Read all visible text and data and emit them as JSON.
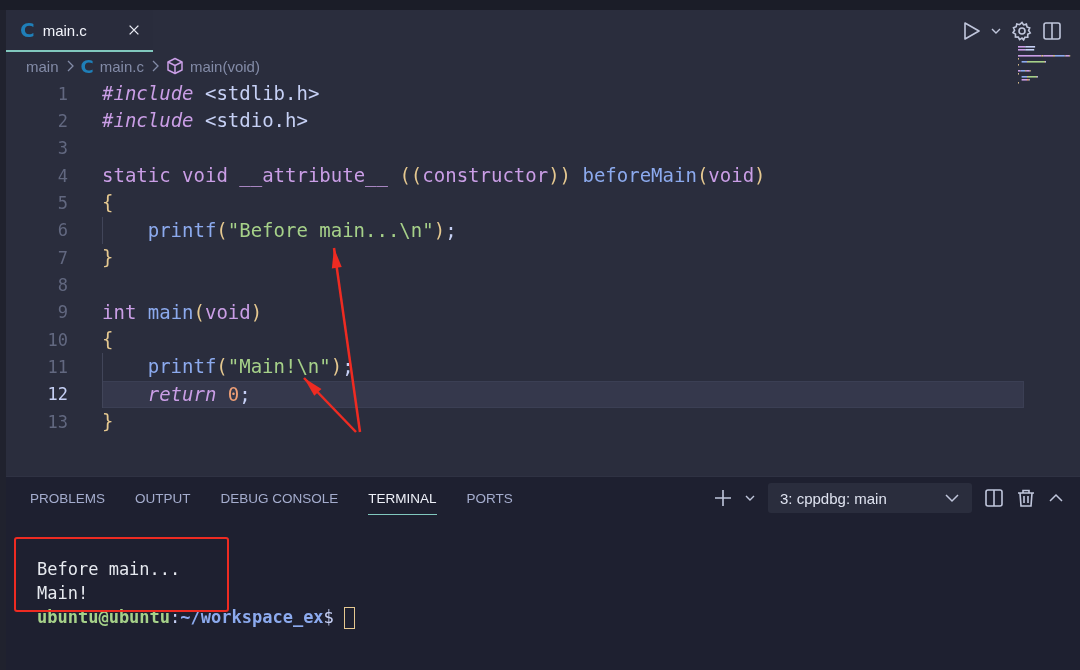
{
  "editor_tabs": [
    {
      "icon": "C",
      "label": "main.c",
      "selected": true
    }
  ],
  "breadcrumbs": [
    {
      "kind": "folder",
      "label": "main"
    },
    {
      "kind": "file",
      "icon": "C",
      "label": "main.c"
    },
    {
      "kind": "symbol",
      "label": "main(void)"
    }
  ],
  "code_lines": [
    {
      "number": "1",
      "current": false,
      "indented": false,
      "tokens": [
        {
          "kind": "directive",
          "text": "#include"
        },
        {
          "kind": "plain",
          "text": " <stdlib.h>"
        }
      ]
    },
    {
      "number": "2",
      "current": false,
      "indented": false,
      "tokens": [
        {
          "kind": "directive",
          "text": "#include"
        },
        {
          "kind": "plain",
          "text": " <stdio.h>"
        }
      ]
    },
    {
      "number": "3",
      "current": false,
      "indented": false
    },
    {
      "number": "4",
      "current": false,
      "indented": false,
      "tokens": [
        {
          "kind": "keyword",
          "text": "static void __attribute__ "
        },
        {
          "kind": "bracket",
          "text": "(("
        },
        {
          "kind": "keyword",
          "text": "constructor"
        },
        {
          "kind": "bracket",
          "text": "))"
        },
        {
          "kind": "function",
          "text": " beforeMain"
        },
        {
          "kind": "bracket",
          "text": "("
        },
        {
          "kind": "keyword",
          "text": "void"
        },
        {
          "kind": "bracket",
          "text": ")"
        }
      ]
    },
    {
      "number": "5",
      "current": false,
      "indented": false,
      "tokens": [
        {
          "kind": "bracket",
          "text": "{"
        }
      ]
    },
    {
      "number": "6",
      "current": false,
      "indented": true,
      "tokens": [
        {
          "kind": "function",
          "text": "printf"
        },
        {
          "kind": "bracket",
          "text": "("
        },
        {
          "kind": "string",
          "text": "\"Before main...\\n\""
        },
        {
          "kind": "bracket",
          "text": ")"
        },
        {
          "kind": "plain",
          "text": ";"
        }
      ]
    },
    {
      "number": "7",
      "current": false,
      "indented": false,
      "tokens": [
        {
          "kind": "bracket",
          "text": "}"
        }
      ]
    },
    {
      "number": "8",
      "current": false,
      "indented": false
    },
    {
      "number": "9",
      "current": false,
      "indented": false,
      "tokens": [
        {
          "kind": "keyword",
          "text": "int"
        },
        {
          "kind": "function",
          "text": " main"
        },
        {
          "kind": "bracket",
          "text": "("
        },
        {
          "kind": "keyword",
          "text": "void"
        },
        {
          "kind": "bracket",
          "text": ")"
        }
      ]
    },
    {
      "number": "10",
      "current": false,
      "indented": false,
      "tokens": [
        {
          "kind": "bracket",
          "text": "{"
        }
      ]
    },
    {
      "number": "11",
      "current": false,
      "indented": true,
      "tokens": [
        {
          "kind": "function",
          "text": "printf"
        },
        {
          "kind": "bracket",
          "text": "("
        },
        {
          "kind": "string",
          "text": "\"Main!\\n\""
        },
        {
          "kind": "bracket",
          "text": ")"
        },
        {
          "kind": "plain",
          "text": ";"
        }
      ]
    },
    {
      "number": "12",
      "current": true,
      "indented": true,
      "tokens": [
        {
          "kind": "control",
          "text": "return"
        },
        {
          "kind": "number",
          "text": " 0"
        },
        {
          "kind": "plain",
          "text": ";"
        }
      ]
    },
    {
      "number": "13",
      "current": false,
      "indented": false,
      "tokens": [
        {
          "kind": "bracket",
          "text": "}"
        }
      ]
    }
  ],
  "panel": {
    "tabs": [
      {
        "label": "PROBLEMS",
        "selected": false
      },
      {
        "label": "OUTPUT",
        "selected": false
      },
      {
        "label": "DEBUG CONSOLE",
        "selected": false
      },
      {
        "label": "TERMINAL",
        "selected": true
      },
      {
        "label": "PORTS",
        "selected": false
      }
    ],
    "terminal_select": "3: cppdbg: main",
    "terminal_lines": [
      {
        "kind": "output",
        "text": "Before main..."
      },
      {
        "kind": "output",
        "text": "Main!"
      },
      {
        "kind": "prompt",
        "user": "ubuntu@ubuntu",
        "separator": ":",
        "path": "~/workspace_ex",
        "symbol": "$"
      }
    ]
  }
}
